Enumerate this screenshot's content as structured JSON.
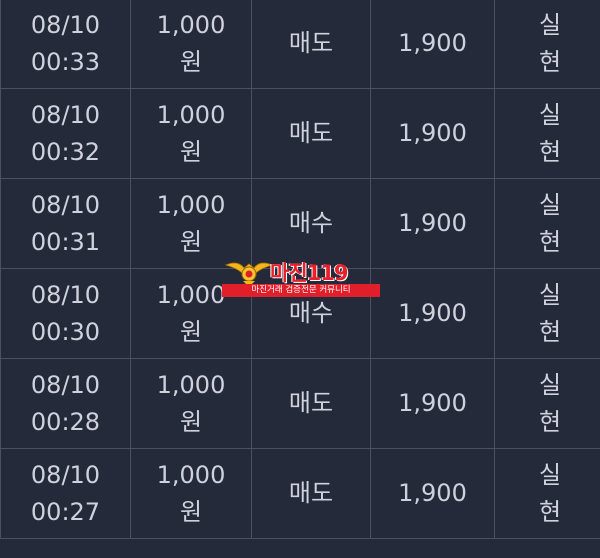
{
  "rows": [
    {
      "date": "08/10",
      "time": "00:33",
      "amount": "1,000",
      "unit": "원",
      "side": "매도",
      "price": "1,900",
      "status_1": "실",
      "status_2": "현"
    },
    {
      "date": "08/10",
      "time": "00:32",
      "amount": "1,000",
      "unit": "원",
      "side": "매도",
      "price": "1,900",
      "status_1": "실",
      "status_2": "현"
    },
    {
      "date": "08/10",
      "time": "00:31",
      "amount": "1,000",
      "unit": "원",
      "side": "매수",
      "price": "1,900",
      "status_1": "실",
      "status_2": "현"
    },
    {
      "date": "08/10",
      "time": "00:30",
      "amount": "1,000",
      "unit": "원",
      "side": "매수",
      "price": "1,900",
      "status_1": "실",
      "status_2": "현"
    },
    {
      "date": "08/10",
      "time": "00:28",
      "amount": "1,000",
      "unit": "원",
      "side": "매도",
      "price": "1,900",
      "status_1": "실",
      "status_2": "현"
    },
    {
      "date": "08/10",
      "time": "00:27",
      "amount": "1,000",
      "unit": "원",
      "side": "매도",
      "price": "1,900",
      "status_1": "실",
      "status_2": "현"
    }
  ],
  "watermark": {
    "title": "마진119",
    "subtitle": "마진거래 검증전문 커뮤니티",
    "logo_icon": "eagle-emblem-icon"
  },
  "colors": {
    "background": "#252a3b",
    "grid": "#4a4f62",
    "text": "#cfd2dc",
    "status": "#5cc16b",
    "watermark_red": "#e11f2a"
  }
}
